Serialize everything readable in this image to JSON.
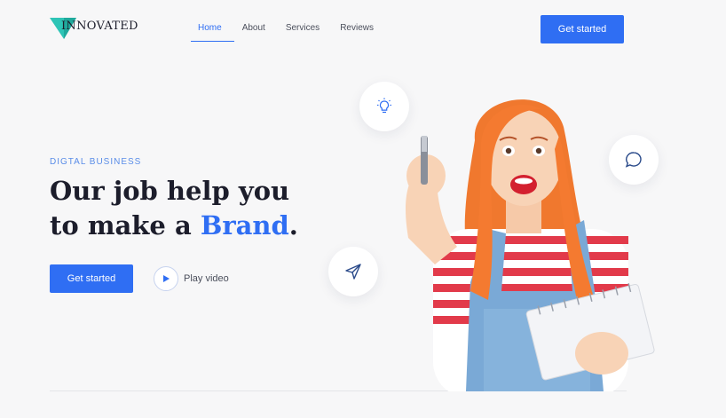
{
  "brand": {
    "name": "INNOVATED",
    "accent": "#2f6ef3",
    "logo_color": "#2ec4b6"
  },
  "nav": {
    "items": [
      {
        "label": "Home",
        "active": true
      },
      {
        "label": "About",
        "active": false
      },
      {
        "label": "Services",
        "active": false
      },
      {
        "label": "Reviews",
        "active": false
      }
    ],
    "cta_label": "Get started"
  },
  "hero": {
    "eyebrow": "DIGTAL BUSINESS",
    "headline_line1": "Our job help you",
    "headline_line2_prefix": "to make a ",
    "headline_highlight": "Brand",
    "headline_suffix": ".",
    "cta_label": "Get started",
    "play_label": "Play video"
  },
  "bubbles": [
    {
      "icon": "lightbulb-icon"
    },
    {
      "icon": "chat-icon"
    },
    {
      "icon": "send-icon"
    }
  ]
}
